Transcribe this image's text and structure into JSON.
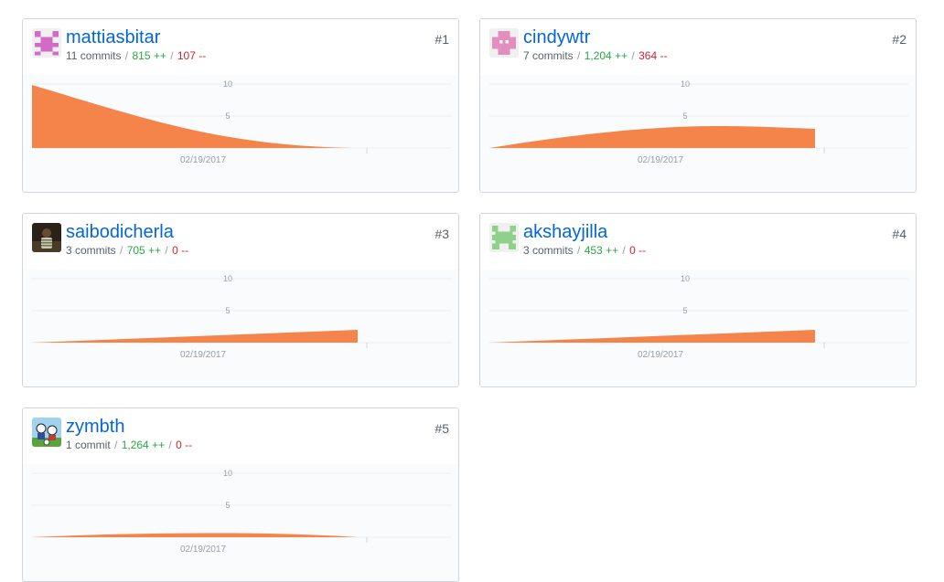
{
  "y_ticks": [
    "10",
    "5"
  ],
  "x_label": "02/19/2017",
  "accent_color": "#f48449",
  "contributors": [
    {
      "username": "mattiasbitar",
      "commits": "11 commits",
      "additions": "815 ++",
      "deletions": "107 --",
      "rank": "#1",
      "avatar": "pink-identicon",
      "trend": "falling"
    },
    {
      "username": "cindywtr",
      "commits": "7 commits",
      "additions": "1,204 ++",
      "deletions": "364 --",
      "rank": "#2",
      "avatar": "pink-identicon",
      "trend": "hump"
    },
    {
      "username": "saibodicherla",
      "commits": "3 commits",
      "additions": "705 ++",
      "deletions": "0 --",
      "rank": "#3",
      "avatar": "photo",
      "trend": "rising"
    },
    {
      "username": "akshayjilla",
      "commits": "3 commits",
      "additions": "453 ++",
      "deletions": "0 --",
      "rank": "#4",
      "avatar": "green-identicon",
      "trend": "rising"
    },
    {
      "username": "zymbth",
      "commits": "1 commit",
      "additions": "1,264 ++",
      "deletions": "0 --",
      "rank": "#5",
      "avatar": "soccer-photo",
      "trend": "flat"
    }
  ]
}
